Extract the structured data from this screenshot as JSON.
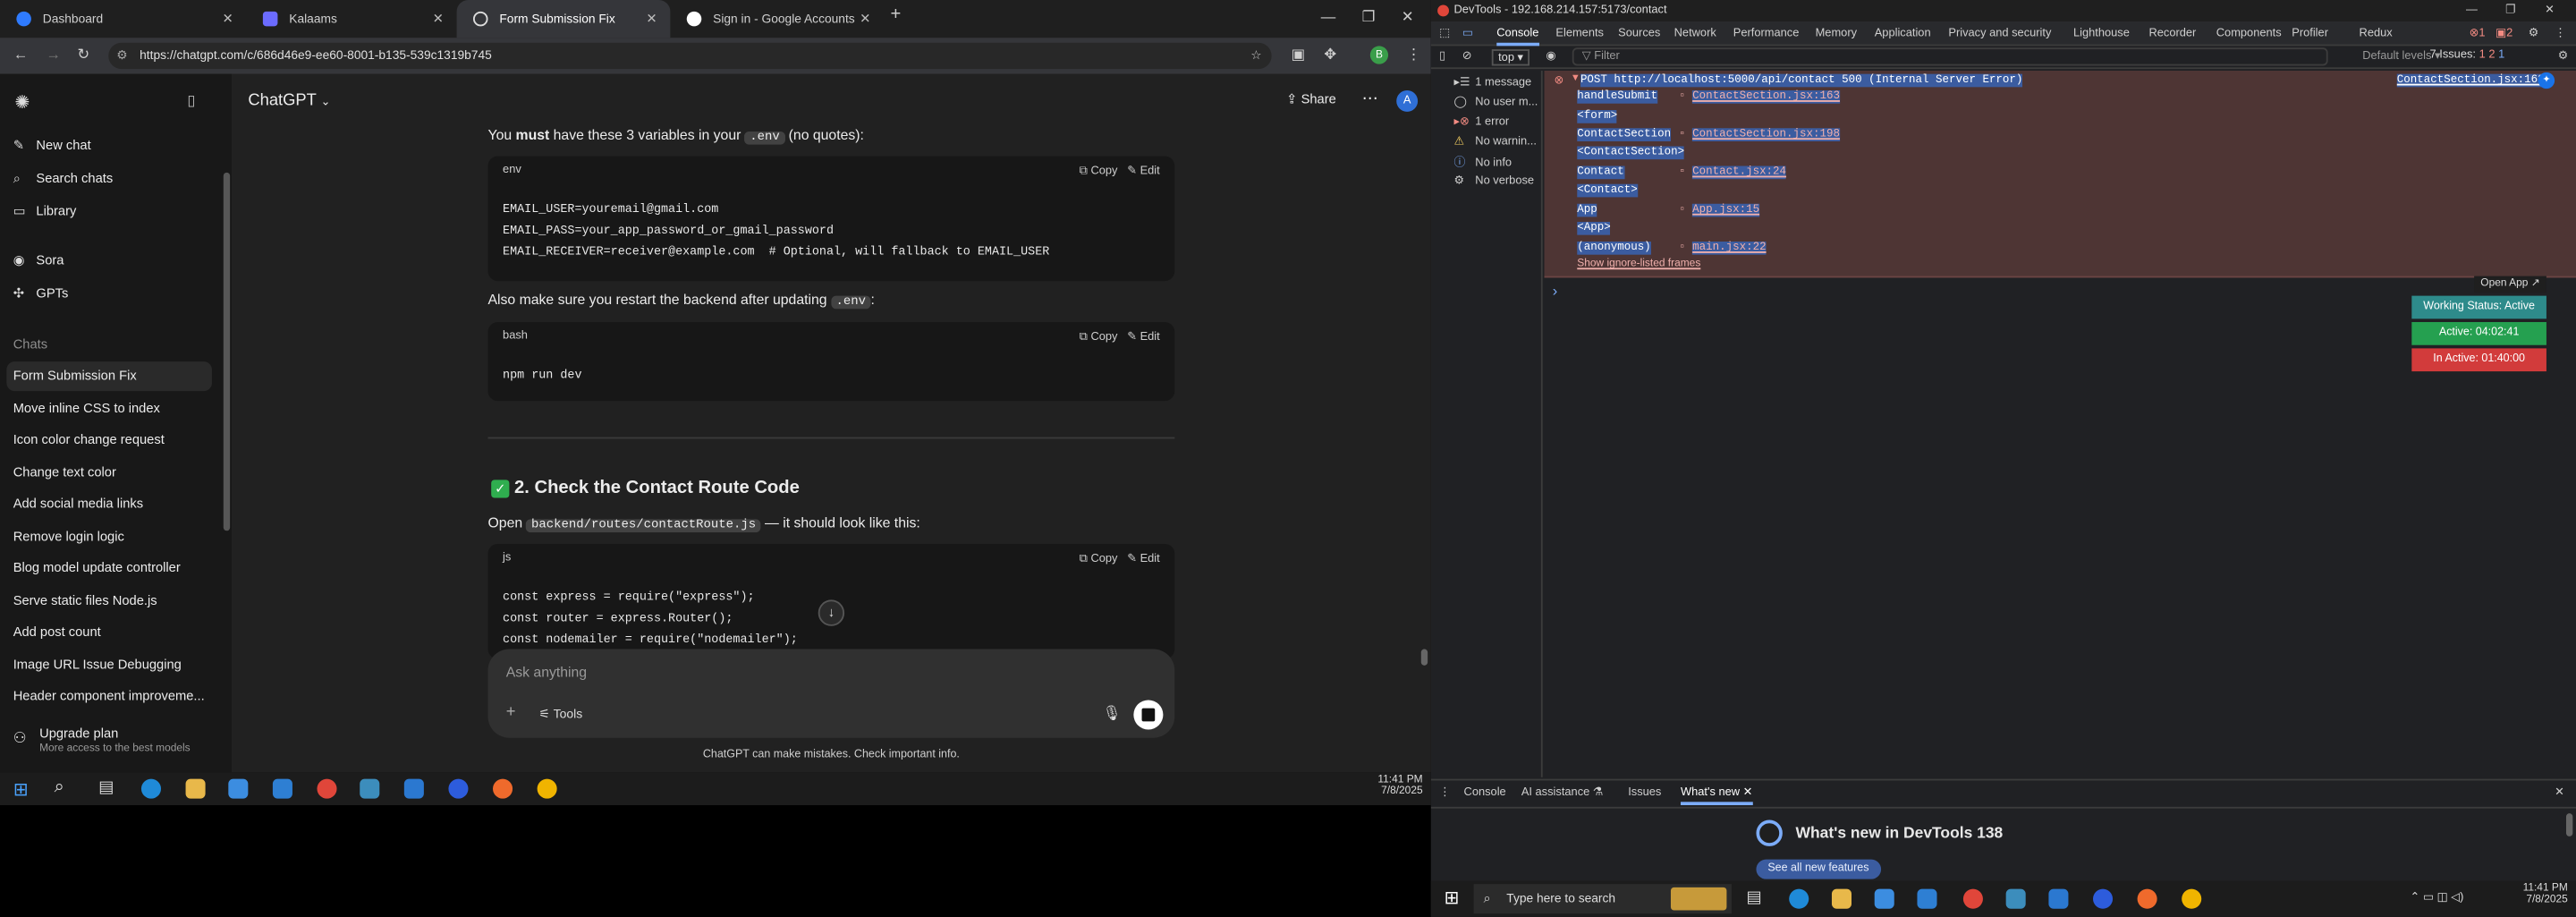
{
  "browser": {
    "tabs": [
      {
        "title": "Dashboard",
        "active": false
      },
      {
        "title": "Kalaams",
        "active": false
      },
      {
        "title": "Form Submission Fix",
        "active": true
      },
      {
        "title": "Sign in - Google Accounts",
        "active": false
      }
    ],
    "url": "https://chatgpt.com/c/686d46e9-ee60-8001-b135-539c1319b745",
    "profile_initial": "B"
  },
  "chat_sidebar": {
    "new_chat": "New chat",
    "search_chats": "Search chats",
    "library": "Library",
    "sora": "Sora",
    "gpts": "GPTs",
    "chats_heading": "Chats",
    "chats": [
      "Form Submission Fix",
      "Move inline CSS to index",
      "Icon color change request",
      "Change text color",
      "Add social media links",
      "Remove login logic",
      "Blog model update controller",
      "Serve static files Node.js",
      "Add post count",
      "Image URL Issue Debugging",
      "Header component improveme..."
    ],
    "upgrade_title": "Upgrade plan",
    "upgrade_sub": "More access to the best models"
  },
  "chat_header": {
    "model": "ChatGPT",
    "share": "Share",
    "avatar_initial": "A"
  },
  "conversation": {
    "intro_pre": "You ",
    "intro_bold": "must",
    "intro_mid": " have these 3 variables in your ",
    "intro_chip": ".env",
    "intro_post": " (no quotes):",
    "copy_label": "Copy",
    "edit_label": "Edit",
    "code1_lang": "env",
    "code1_lines": [
      "EMAIL_USER=youremail@gmail.com",
      "EMAIL_PASS=your_app_password_or_gmail_password",
      "EMAIL_RECEIVER=receiver@example.com  # Optional, will fallback to EMAIL_USER"
    ],
    "restart_pre": "Also make sure you restart the backend after updating ",
    "restart_chip": ".env",
    "restart_post": ":",
    "code2_lang": "bash",
    "code2_lines": [
      "npm run dev"
    ],
    "section_title": "2. Check the Contact Route Code",
    "open_pre": "Open ",
    "open_chip": "backend/routes/contactRoute.js",
    "open_post": " — it should look like this:",
    "code3_lang": "js",
    "code3_lines": [
      "const express = require(\"express\");",
      "const router = express.Router();",
      "const nodemailer = require(\"nodemailer\");"
    ],
    "composer_placeholder": "Ask anything",
    "tools_label": "Tools",
    "disclaimer": "ChatGPT can make mistakes. Check important info."
  },
  "taskbar_left": {
    "time": "11:41 PM",
    "date": "7/8/2025"
  },
  "devtools": {
    "title": "DevTools - 192.168.214.157:5173/contact",
    "tabs": [
      "Console",
      "Elements",
      "Sources",
      "Network",
      "Performance",
      "Memory",
      "Application",
      "Privacy and security",
      "Lighthouse",
      "Recorder",
      "Components",
      "Profiler",
      "Redux"
    ],
    "error_count": "1",
    "warn_count": "2",
    "context": "top",
    "filter_placeholder": "Filter",
    "levels": "Default levels",
    "issues": "7 Issues:",
    "issue_err": "1",
    "issue_warn": "2",
    "issue_info": "1",
    "sidebar": [
      "1 message",
      "No user m...",
      "1 error",
      "No warnin...",
      "No info",
      "No verbose"
    ],
    "error_line": "POST http://localhost:5000/api/contact 500 (Internal Server Error)",
    "error_source": "ContactSection.jsx:163",
    "stack": [
      {
        "fn": "handleSubmit",
        "loc": "ContactSection.jsx:163"
      },
      {
        "fn": "<form>",
        "loc": ""
      },
      {
        "fn": "ContactSection",
        "loc": "ContactSection.jsx:198"
      },
      {
        "fn": "<ContactSection>",
        "loc": ""
      },
      {
        "fn": "Contact",
        "loc": "Contact.jsx:24"
      },
      {
        "fn": "<Contact>",
        "loc": ""
      },
      {
        "fn": "App",
        "loc": "App.jsx:15"
      },
      {
        "fn": "<App>",
        "loc": ""
      },
      {
        "fn": "(anonymous)",
        "loc": "main.jsx:22"
      }
    ],
    "ignore_listed": "Show ignore-listed frames",
    "prompt": "›",
    "timer": {
      "open_app": "Open App",
      "working": "Working Status: Active",
      "active": "Active: 04:02:41",
      "inactive": "In Active: 01:40:00"
    },
    "drawer_tabs": [
      "Console",
      "AI assistance",
      "Issues",
      "What's new"
    ],
    "whats_new": "What's new in DevTools 138",
    "see_all": "See all new features"
  },
  "taskbar_right": {
    "search_placeholder": "Type here to search",
    "time": "11:41 PM",
    "date": "7/8/2025"
  },
  "colors": {
    "error_bg": "#4e3534",
    "timer_green": "#25a050",
    "timer_red": "#d23b3b",
    "timer_teal": "#2e8b8b"
  }
}
